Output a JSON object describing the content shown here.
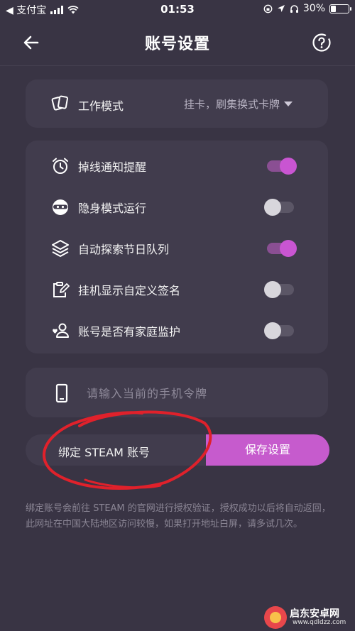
{
  "status": {
    "back_app": "◀ 支付宝",
    "time": "01:53",
    "battery": "30%",
    "battery_level": 0.3
  },
  "header": {
    "title": "账号设置"
  },
  "mode": {
    "label": "工作模式",
    "value": "挂卡，刷集换式卡牌"
  },
  "toggles": [
    {
      "label": "掉线通知提醒",
      "on": true
    },
    {
      "label": "隐身模式运行",
      "on": false
    },
    {
      "label": "自动探索节日队列",
      "on": true
    },
    {
      "label": "挂机显示自定义签名",
      "on": false
    },
    {
      "label": "账号是否有家庭监护",
      "on": false
    }
  ],
  "token": {
    "placeholder": "请输入当前的手机令牌"
  },
  "actions": {
    "bind_label": "绑定 STEAM 账号",
    "save_label": "保存设置"
  },
  "note": "绑定账号会前往 STEAM 的官网进行授权验证，授权成功以后将自动返回，此网址在中国大陆地区访问较慢，如果打开地址白屏，请多试几次。",
  "watermark": {
    "name": "启东安卓网",
    "url": "www.qdldzz.com"
  },
  "colors": {
    "background": "#393444",
    "card": "#413c4d",
    "accent": "#c65bcd",
    "annotation": "#e0212b"
  }
}
